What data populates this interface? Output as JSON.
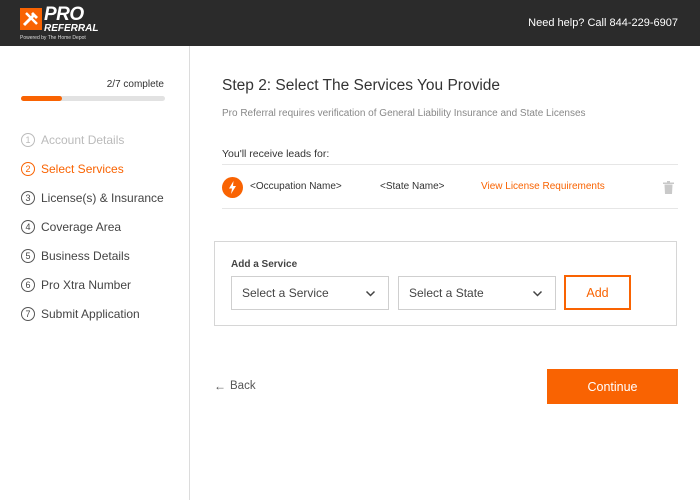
{
  "header": {
    "logo_primary": "PRO",
    "logo_secondary": "REFERRAL",
    "logo_tagline": "Powered by The Home Depot",
    "help_text": "Need help? Call 844-229-6907"
  },
  "sidebar": {
    "progress_text": "2/7 complete",
    "progress_fraction": 0.286,
    "steps": [
      {
        "num": "1",
        "label": "Account Details",
        "state": "done"
      },
      {
        "num": "2",
        "label": "Select Services",
        "state": "active"
      },
      {
        "num": "3",
        "label": "License(s) & Insurance",
        "state": "pending"
      },
      {
        "num": "4",
        "label": "Coverage Area",
        "state": "pending"
      },
      {
        "num": "5",
        "label": "Business Details",
        "state": "pending"
      },
      {
        "num": "6",
        "label": "Pro Xtra Number",
        "state": "pending"
      },
      {
        "num": "7",
        "label": "Submit Application",
        "state": "pending"
      }
    ]
  },
  "main": {
    "title": "Step 2: Select The Services You Provide",
    "subtitle": "Pro Referral requires verification of General Liability Insurance and State Licenses",
    "leads_label": "You'll receive leads for:",
    "lead": {
      "icon": "bolt-icon",
      "occupation": "<Occupation Name>",
      "state": "<State Name>",
      "link": "View License Requirements",
      "delete_icon": "trash-icon"
    },
    "add_service": {
      "label": "Add a Service",
      "service_select": "Select a Service",
      "state_select": "Select a State",
      "add_button": "Add"
    },
    "back_label": "Back",
    "continue_label": "Continue"
  },
  "colors": {
    "accent": "#f96302",
    "header_bg": "#2b2b2b"
  }
}
